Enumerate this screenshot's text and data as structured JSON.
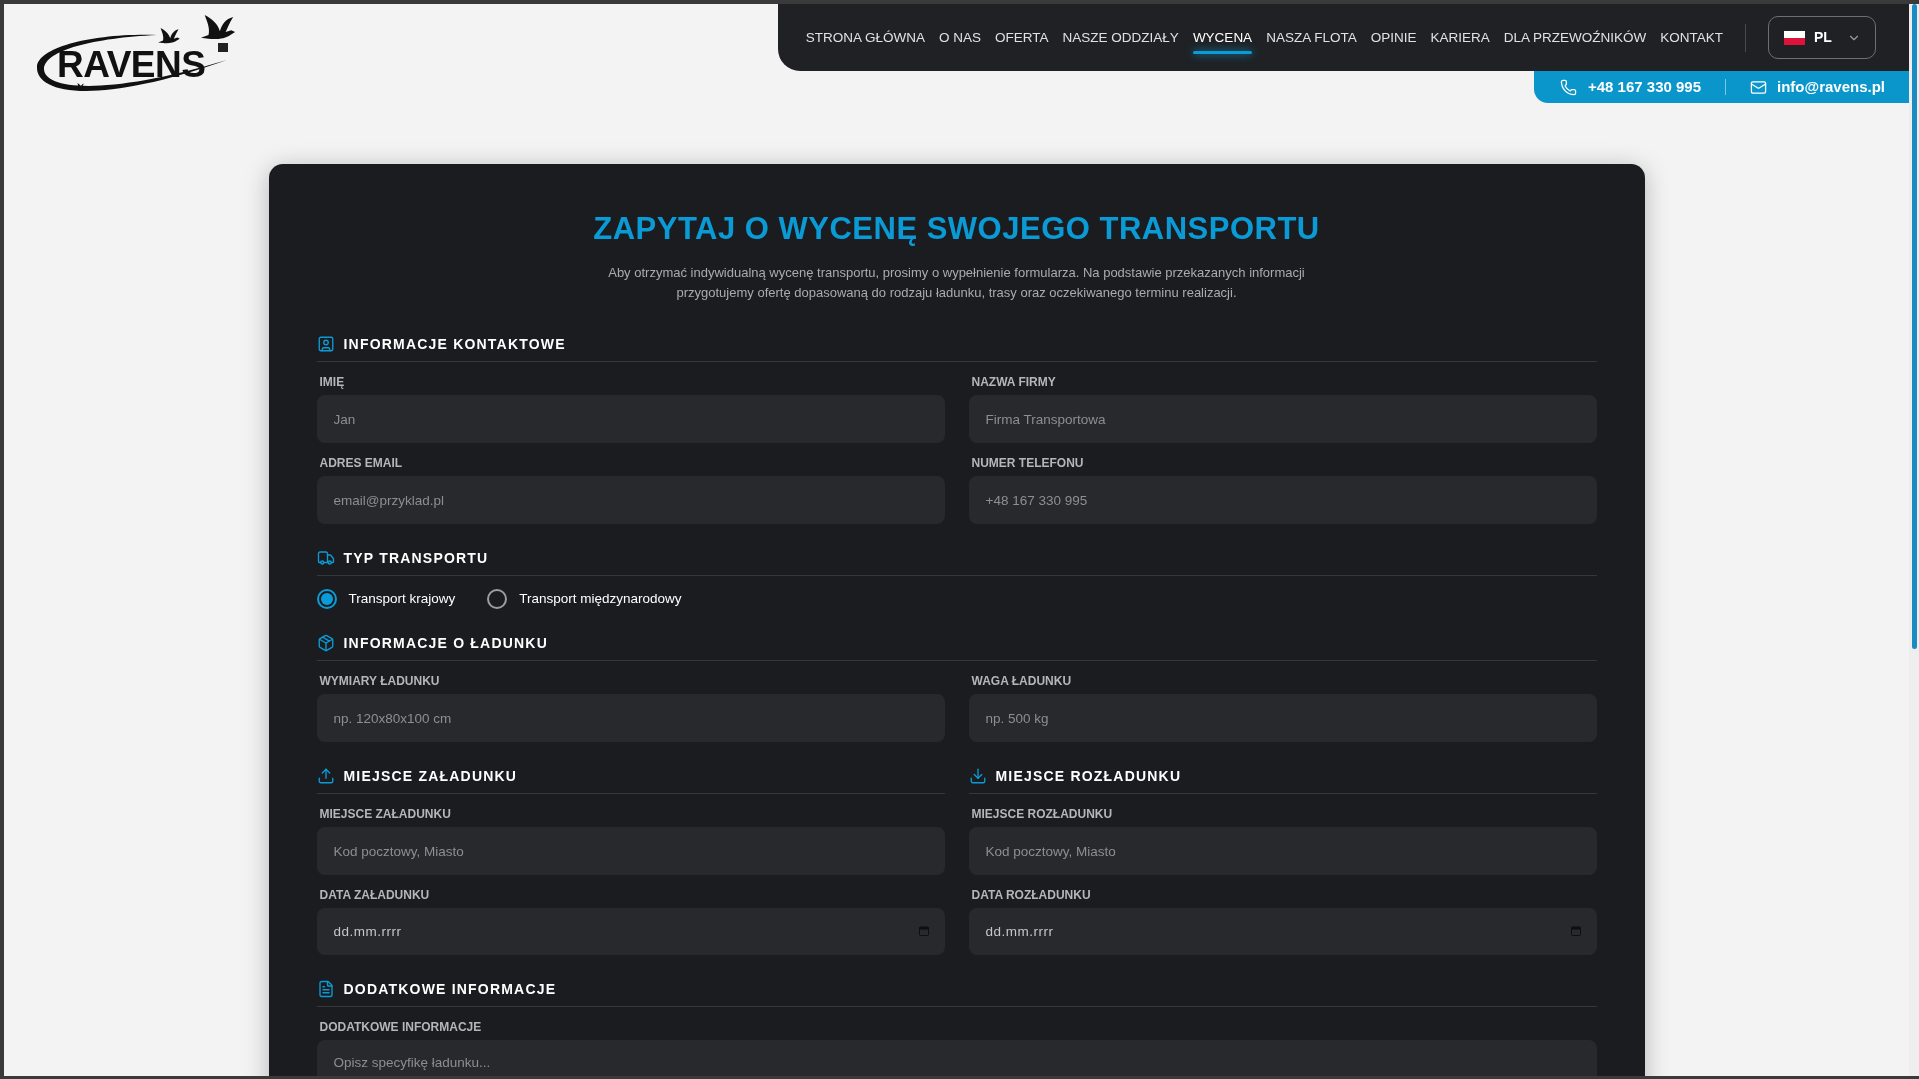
{
  "logo": {
    "text": "RAVENS"
  },
  "nav": {
    "items": [
      {
        "label": "STRONA GŁÓWNA",
        "selected": false
      },
      {
        "label": "O NAS",
        "selected": false
      },
      {
        "label": "OFERTA",
        "selected": false
      },
      {
        "label": "NASZE ODDZIAŁY",
        "selected": false
      },
      {
        "label": "WYCENA",
        "selected": true
      },
      {
        "label": "NASZA FLOTA",
        "selected": false
      },
      {
        "label": "OPINIE",
        "selected": false
      },
      {
        "label": "KARIERA",
        "selected": false
      },
      {
        "label": "DLA PRZEWOŹNIKÓW",
        "selected": false
      },
      {
        "label": "KONTAKT",
        "selected": false
      }
    ],
    "language": {
      "code": "PL"
    }
  },
  "contact_bar": {
    "phone": "+48 167 330 995",
    "email": "info@ravens.pl"
  },
  "form": {
    "title": "ZAPYTAJ O WYCENĘ SWOJEGO TRANSPORTU",
    "description": "Aby otrzymać indywidualną wycenę transportu, prosimy o wypełnienie formularza. Na podstawie przekazanych informacji przygotujemy ofertę dopasowaną do rodzaju ładunku, trasy oraz oczekiwanego terminu realizacji.",
    "rows": [
      {
        "sections": [
          {
            "kind": "contact",
            "title": "INFORMACJE KONTAKTOWE",
            "fields": [
              {
                "kind": "text",
                "label": "IMIĘ",
                "placeholder": "Jan"
              },
              {
                "kind": "text",
                "label": "NAZWA FIRMY",
                "placeholder": "Firma Transportowa"
              },
              {
                "kind": "text",
                "label": "ADRES EMAIL",
                "placeholder": "email@przyklad.pl"
              },
              {
                "kind": "text",
                "label": "NUMER TELEFONU",
                "placeholder": "+48 167 330 995"
              }
            ]
          }
        ]
      },
      {
        "sections": [
          {
            "kind": "transport_type",
            "title": "TYP TRANSPORTU",
            "options": [
              {
                "label": "Transport krajowy",
                "selected": true
              },
              {
                "label": "Transport międzynarodowy",
                "selected": false
              }
            ]
          }
        ]
      },
      {
        "sections": [
          {
            "kind": "cargo",
            "title": "INFORMACJE O ŁADUNKU",
            "fields": [
              {
                "kind": "text",
                "label": "WYMIARY ŁADUNKU",
                "placeholder": "np. 120x80x100 cm"
              },
              {
                "kind": "text",
                "label": "WAGA ŁADUNKU",
                "placeholder": "np. 500 kg"
              }
            ]
          }
        ]
      },
      {
        "sections": [
          {
            "kind": "loading",
            "title": "MIEJSCE ZAŁADUNKU",
            "fields": [
              {
                "kind": "text",
                "label": "MIEJSCE ZAŁADUNKU",
                "placeholder": "Kod pocztowy, Miasto"
              },
              {
                "kind": "date",
                "label": "DATA ZAŁADUNKU",
                "placeholder": "dd.mm.rrrr"
              }
            ]
          },
          {
            "kind": "unloading",
            "title": "MIEJSCE ROZŁADUNKU",
            "fields": [
              {
                "kind": "text",
                "label": "MIEJSCE ROZŁADUNKU",
                "placeholder": "Kod pocztowy, Miasto"
              },
              {
                "kind": "date",
                "label": "DATA ROZŁADUNKU",
                "placeholder": "dd.mm.rrrr"
              }
            ]
          }
        ]
      },
      {
        "sections": [
          {
            "kind": "notes",
            "title": "DODATKOWE INFORMACJE",
            "fields": [
              {
                "kind": "textarea",
                "label": "DODATKOWE INFORMACJE",
                "placeholder": "Opisz specyfikę ładunku..."
              }
            ]
          }
        ]
      }
    ]
  }
}
